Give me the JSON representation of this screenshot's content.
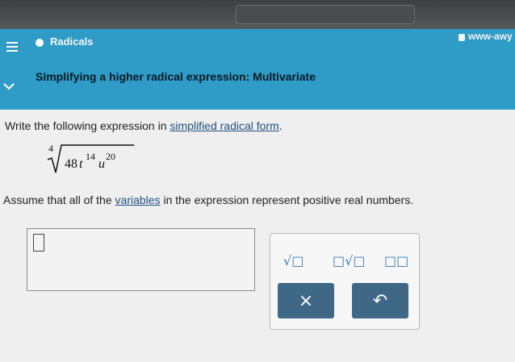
{
  "browser": {
    "url": "www-awy"
  },
  "header": {
    "topic": "Radicals",
    "title": "Simplifying a higher radical expression: Multivariate"
  },
  "question": {
    "instruction_prefix": "Write the following expression in ",
    "instruction_link": "simplified radical form",
    "instruction_suffix": ".",
    "expression": {
      "index": "4",
      "coefficient": "48",
      "var1": "t",
      "exp1": "14",
      "var2": "u",
      "exp2": "20"
    },
    "note_prefix": "Assume that all of the ",
    "note_link": "variables",
    "note_suffix": " in the expression represent positive real numbers."
  },
  "palette": {
    "sqrt_icon": "√□",
    "nthroot_icon": "□√□",
    "power_icon": "□□",
    "clear_label": "×",
    "undo_label": "↶"
  },
  "colors": {
    "header": "#2f9bc7",
    "button": "#3f6786",
    "tool": "#3a78b8"
  }
}
